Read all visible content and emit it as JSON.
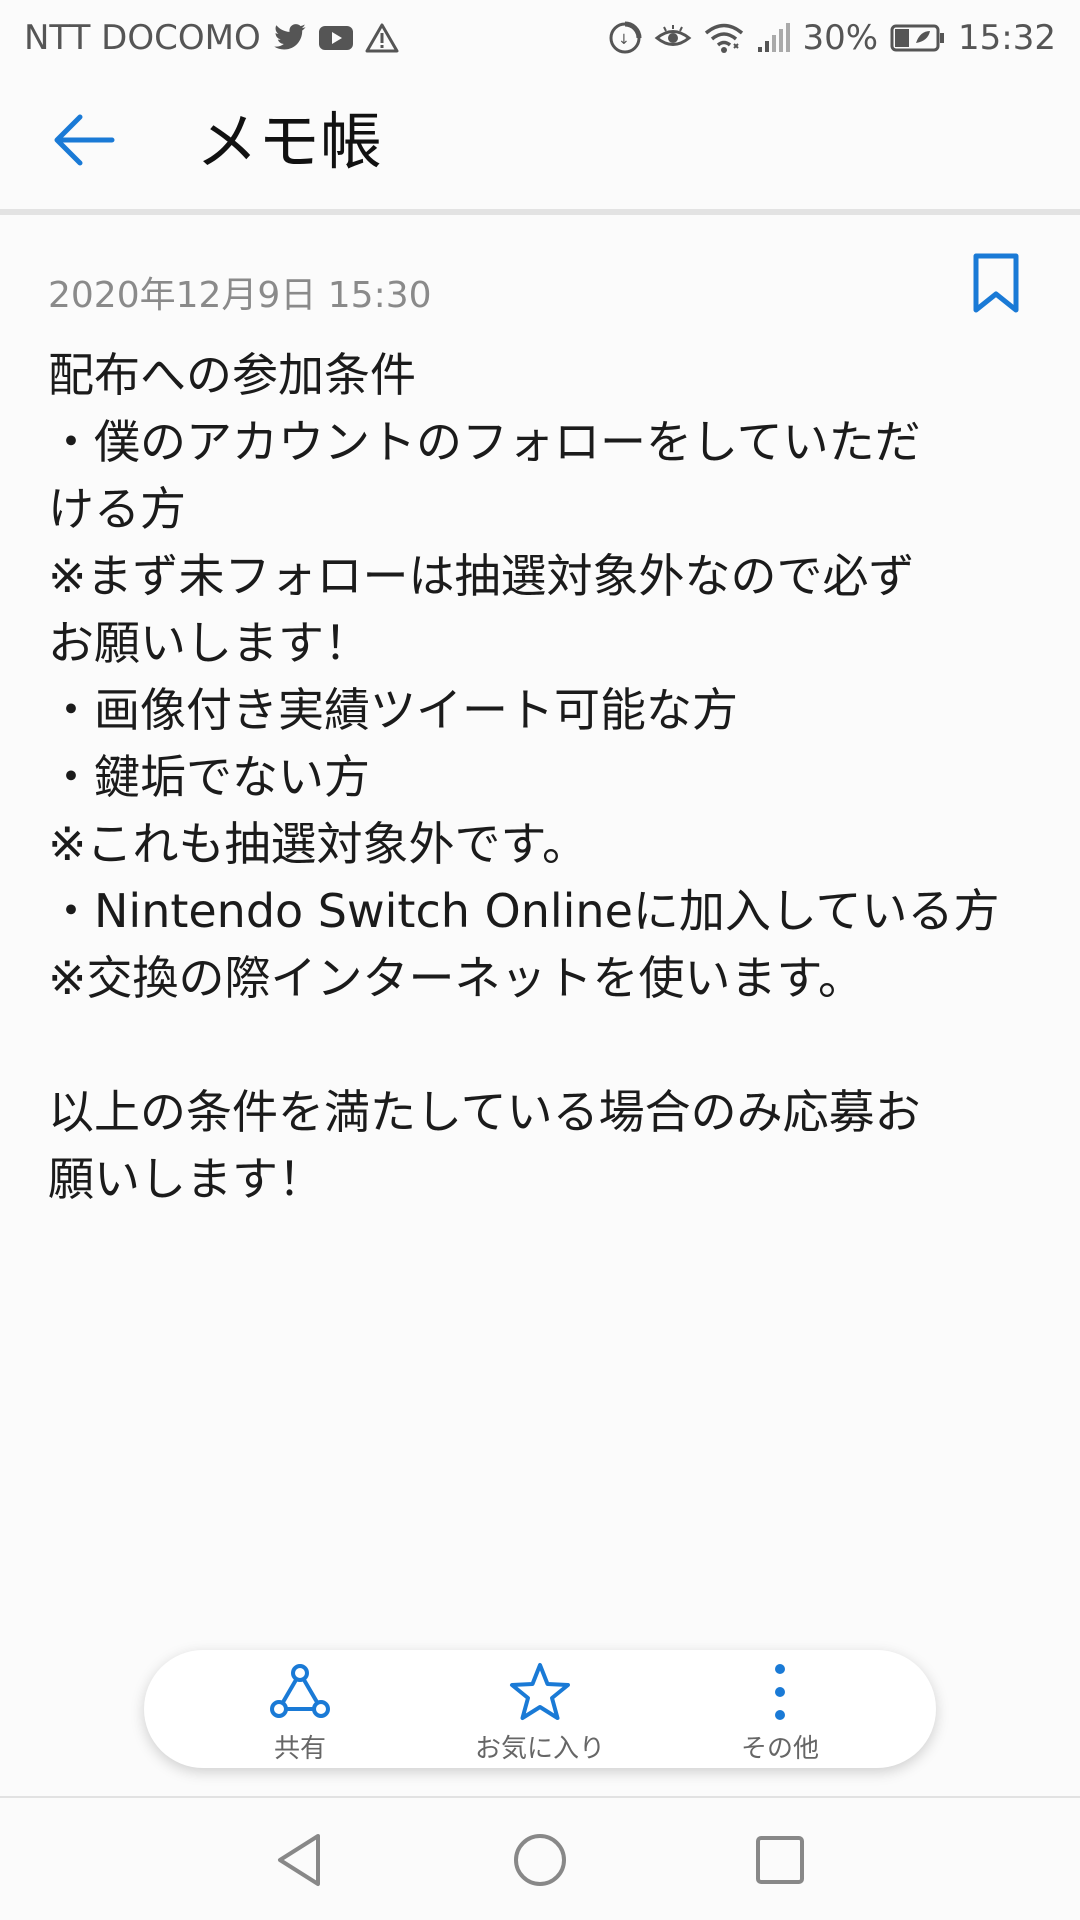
{
  "status_bar": {
    "carrier": "NTT DOCOMO",
    "battery": "30%",
    "time": "15:32"
  },
  "app_bar": {
    "title": "メモ帳"
  },
  "note": {
    "date": "2020年12月9日 15:30",
    "lines": [
      "配布への参加条件",
      "・僕のアカウントのフォローをしていただ",
      "ける方",
      "※まず未フォローは抽選対象外なので必ず",
      "お願いします！",
      "・画像付き実績ツイート可能な方",
      "・鍵垢でない方",
      "※これも抽選対象外です。",
      "・Nintendo Switch Onlineに加入している方",
      "※交換の際インターネットを使います。",
      "",
      "以上の条件を満たしている場合のみ応募お",
      "願いします！"
    ]
  },
  "actions": {
    "share_label": "共有",
    "favorite_label": "お気に入り",
    "more_label": "その他"
  },
  "colors": {
    "accent": "#1a7ad6",
    "icon_gray": "#555555"
  }
}
